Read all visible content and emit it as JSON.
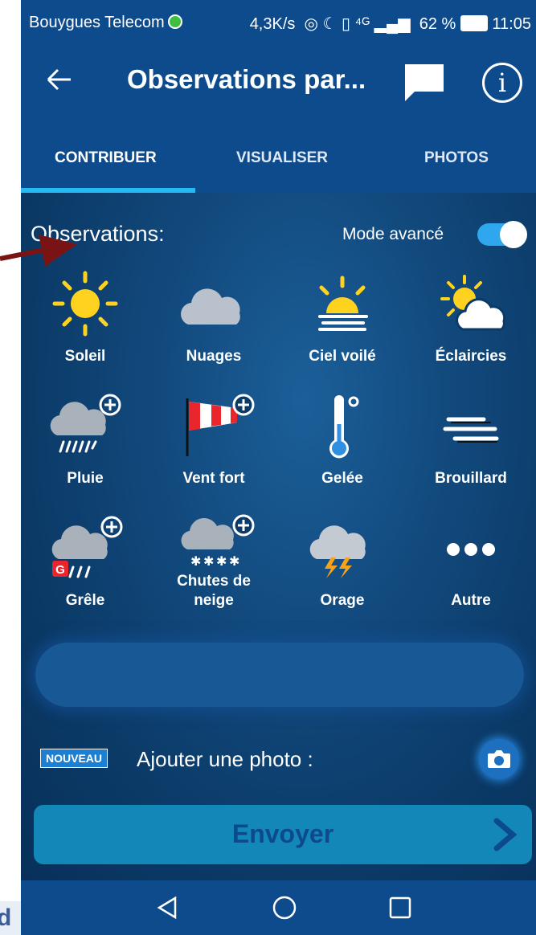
{
  "status_bar": {
    "carrier": "Bouygues Telecom",
    "network": "4,3K/s",
    "battery": "62 %",
    "time": "11:05"
  },
  "app_bar": {
    "title": "Observations par...",
    "icons": [
      "back-arrow-icon",
      "chat-icon",
      "info-icon"
    ]
  },
  "tabs": [
    {
      "label": "CONTRIBUER",
      "active": true
    },
    {
      "label": "VISUALISER",
      "active": false
    },
    {
      "label": "PHOTOS",
      "active": false
    }
  ],
  "observations": {
    "heading": "Observations:",
    "advanced_mode_label": "Mode avancé",
    "advanced_mode_on": true,
    "items": [
      {
        "label": "Soleil",
        "icon": "sun-icon"
      },
      {
        "label": "Nuages",
        "icon": "cloud-icon"
      },
      {
        "label": "Ciel voilé",
        "icon": "veiled-sun-icon"
      },
      {
        "label": "Éclaircies",
        "icon": "sun-cloud-icon"
      },
      {
        "label": "Pluie",
        "icon": "rain-icon"
      },
      {
        "label": "Vent fort",
        "icon": "windsock-icon"
      },
      {
        "label": "Gelée",
        "icon": "thermometer-icon"
      },
      {
        "label": "Brouillard",
        "icon": "fog-icon"
      },
      {
        "label": "Grêle",
        "icon": "hail-icon"
      },
      {
        "label": "Chutes de neige",
        "icon": "snow-icon"
      },
      {
        "label": "Orage",
        "icon": "storm-icon"
      },
      {
        "label": "Autre",
        "icon": "more-icon"
      }
    ]
  },
  "photo": {
    "badge": "NOUVEAU",
    "label": "Ajouter une photo :"
  },
  "send_button": "Envoyer",
  "hail_badge": "G",
  "colors": {
    "primary": "#0e4b8c",
    "accent": "#27b9f2",
    "sun": "#ffd21f",
    "send": "#1287b8"
  }
}
